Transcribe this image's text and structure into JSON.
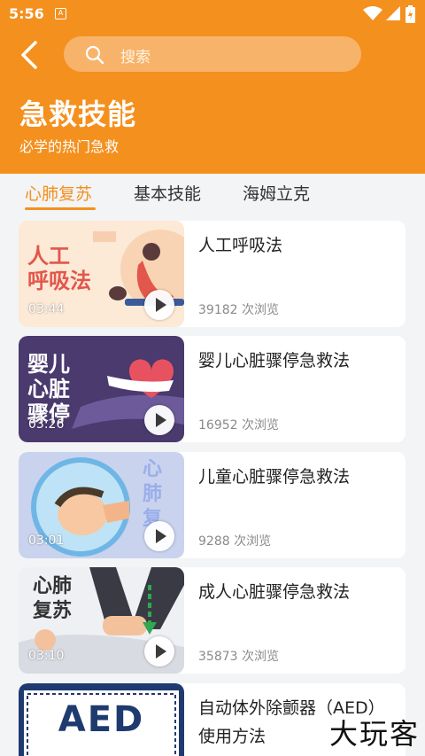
{
  "status_bar": {
    "time": "5:56",
    "notification": "A"
  },
  "search": {
    "placeholder": "搜索"
  },
  "page": {
    "title": "急救技能",
    "subtitle": "必学的热门急救"
  },
  "tabs": [
    {
      "label": "心肺复苏",
      "active": true
    },
    {
      "label": "基本技能",
      "active": false
    },
    {
      "label": "海姆立克",
      "active": false
    }
  ],
  "videos": [
    {
      "title": "人工呼吸法",
      "views": "39182 次浏览",
      "duration": "03:44",
      "thumb_text": [
        "人工",
        "呼吸法"
      ]
    },
    {
      "title": "婴儿心脏骤停急救法",
      "views": "16952 次浏览",
      "duration": "03:26",
      "thumb_text": [
        "婴儿",
        "心脏",
        "骤停"
      ]
    },
    {
      "title": "儿童心脏骤停急救法",
      "views": "9288 次浏览",
      "duration": "03:01",
      "thumb_text": [
        "心",
        "肺",
        "复"
      ]
    },
    {
      "title": "成人心脏骤停急救法",
      "views": "35873 次浏览",
      "duration": "03:10",
      "thumb_text": [
        "心肺",
        "复苏"
      ]
    },
    {
      "title": "自动体外除颤器（AED）使用方法",
      "views": "",
      "duration": "",
      "thumb_text": [
        "AED"
      ]
    }
  ],
  "watermark": "大玩客",
  "colors": {
    "accent": "#f4901e",
    "search_bg": "#f8b36a"
  }
}
